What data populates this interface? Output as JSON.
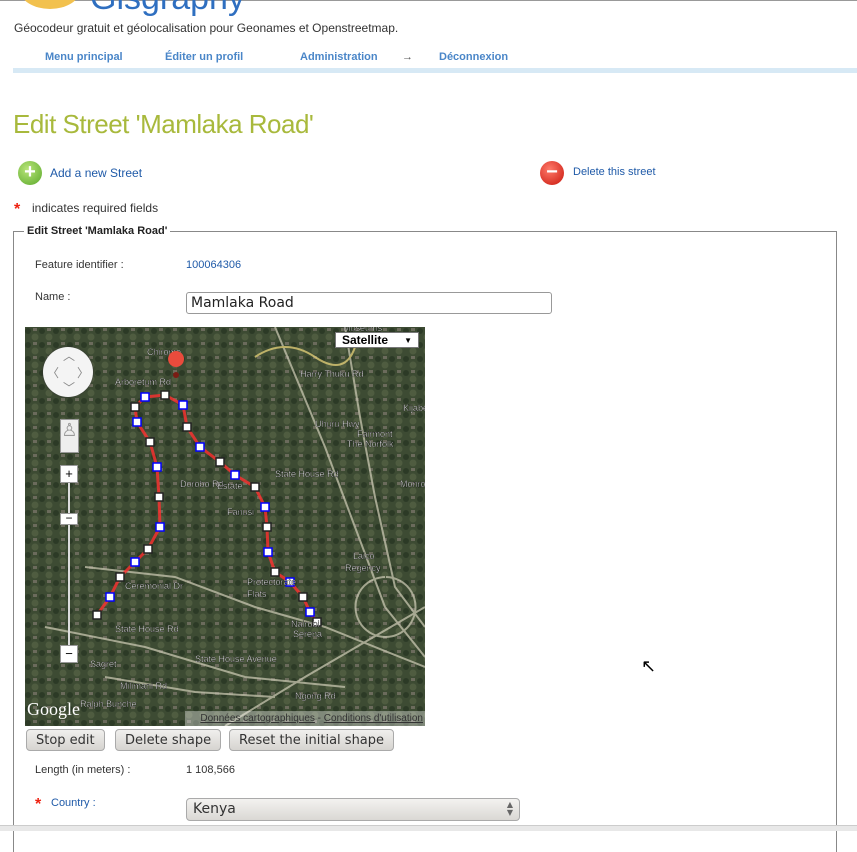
{
  "header": {
    "logo_text": "Gisgraphy",
    "tagline": "Géocodeur gratuit et géolocalisation pour Geonames et Openstreetmap.",
    "nav": [
      {
        "label": "Menu principal"
      },
      {
        "label": "Éditer un profil"
      },
      {
        "label": "Administration"
      },
      {
        "label": "→"
      },
      {
        "label": "Déconnexion"
      }
    ]
  },
  "page": {
    "title": "Edit Street 'Mamlaka Road'",
    "add_link": "Add a new Street",
    "delete_link": "Delete this street",
    "required_note": "indicates required fields"
  },
  "form": {
    "legend": "Edit Street 'Mamlaka Road'",
    "feature_id_label": "Feature identifier :",
    "feature_id_value": "100064306",
    "name_label": "Name :",
    "name_value": "Mamlaka Road",
    "length_label": "Length (in meters) :",
    "length_value": "1 108,566",
    "country_label": "Country :",
    "country_value": "Kenya"
  },
  "map": {
    "type_selector": "Satellite",
    "attribution_data": "Données cartographiques",
    "attribution_sep": " - ",
    "attribution_terms": "Conditions d'utilisation",
    "google": "Google",
    "labels": [
      "Chiromo",
      "Arboretum Rd",
      "Dorobo Rd",
      "Estate",
      "Fanusi",
      "State House Rd",
      "Ceremonial Dr",
      "State House Rd",
      "State House Avenue",
      "Sagret",
      "Milimani Rd",
      "Ralph Bunche",
      "Protectorate",
      "Flats",
      "Nairobi",
      "Serena",
      "Laico",
      "Regency",
      "Fairmont",
      "The Norfolk",
      "Harry Thuku Rd",
      "Uhuru Hwy",
      "Museums",
      "Ngong Rd",
      "Kijabe",
      "Monrovia"
    ]
  },
  "buttons": {
    "stop_edit": "Stop edit",
    "delete_shape": "Delete shape",
    "reset_shape": "Reset the initial shape"
  },
  "colors": {
    "title": "#a8b93c",
    "link": "#1f5aa8",
    "nav": "#4a86c8",
    "polyline": "#ff0000",
    "vertex": "#0000ff"
  }
}
